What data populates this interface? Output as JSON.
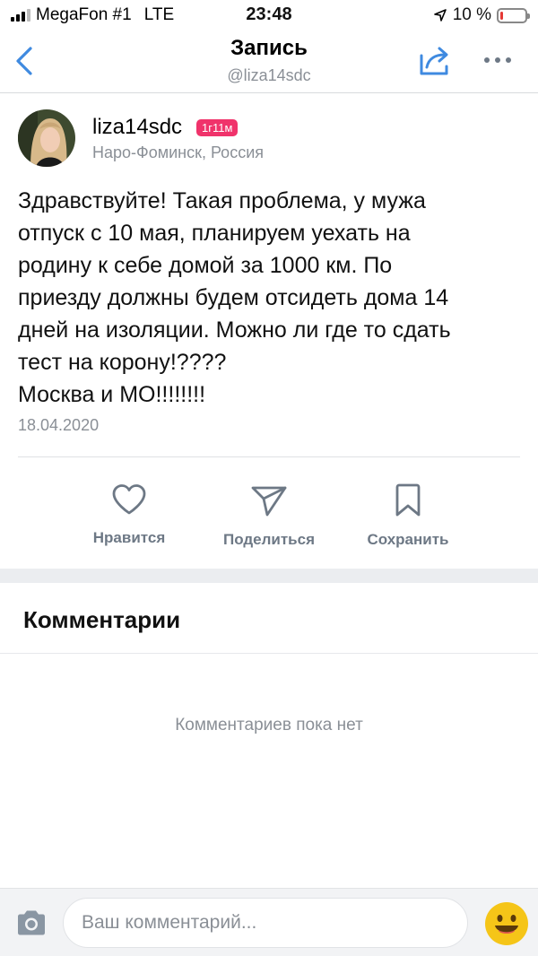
{
  "status_bar": {
    "carrier": "MegaFon #1",
    "network": "LTE",
    "time": "23:48",
    "battery_percent_label": "10 %",
    "battery_level": 0.1,
    "location_icon": "location-arrow-icon"
  },
  "nav": {
    "title": "Запись",
    "subtitle": "@liza14sdc",
    "back_icon": "chevron-left-icon",
    "share_icon": "share-icon",
    "more_icon": "more-dots-icon"
  },
  "post": {
    "author_name": "liza14sdc",
    "age_badge": "1г11м",
    "location": "Наро-Фоминск, Россия",
    "text": "Здравствуйте! Такая проблема, у мужа\nотпуск с 10 мая, планируем уехать на\nродину к себе домой за 1000 км. По\nприезду должны будем отсидеть дома 14\nдней на изоляции. Можно ли где то сдать\nтест на корону!????\nМосква и МО!!!!!!!!",
    "date": "18.04.2020"
  },
  "actions": {
    "like_label": "Нравится",
    "share_label": "Поделиться",
    "save_label": "Сохранить"
  },
  "comments": {
    "title": "Комментарии",
    "empty_text": "Комментариев пока нет"
  },
  "input": {
    "placeholder": "Ваш комментарий..."
  },
  "colors": {
    "accent_badge": "#f0336b",
    "icon_gray": "#6d7885",
    "secondary_text": "#8a8f96",
    "emoji_yellow": "#f5c518"
  }
}
